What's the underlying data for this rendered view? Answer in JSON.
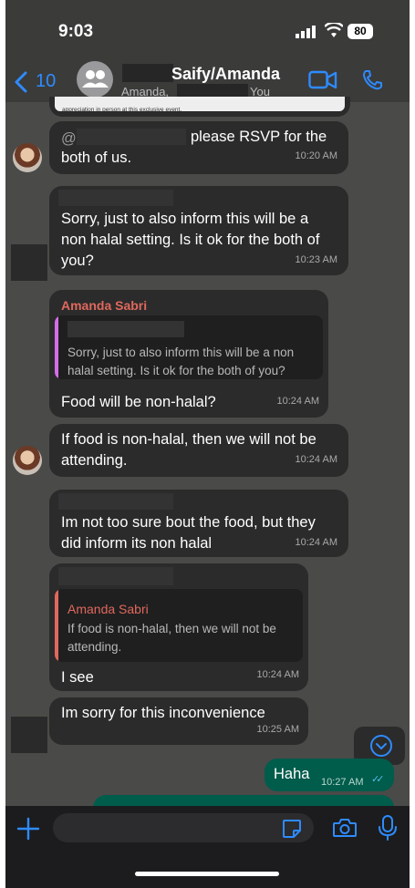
{
  "status_bar": {
    "time": "9:03",
    "battery": "80"
  },
  "header": {
    "back_count": "10",
    "title": "Saify/Amanda",
    "members_prefix": "Amanda,",
    "members_suffix": "You",
    "top_snippet": "appreciation in person at this exclusive event."
  },
  "messages": [
    {
      "id": "m1",
      "at": "@",
      "text": "please RSVP for the",
      "text2": "both of us.",
      "time": "10:20 AM"
    },
    {
      "id": "m2",
      "lines": [
        "Sorry, just to also inform this will be a",
        "non halal setting. Is it ok for the both of",
        "you?"
      ],
      "time": "10:23 AM"
    },
    {
      "id": "m3",
      "sender": "Amanda Sabri",
      "quote_lines": [
        "Sorry, just to also inform this will be a non",
        "halal setting. Is it ok for the both of you?"
      ],
      "text": "Food will be non-halal?",
      "time": "10:24 AM"
    },
    {
      "id": "m4",
      "lines": [
        "If food is non-halal, then we will not be",
        "attending."
      ],
      "time": "10:24 AM"
    },
    {
      "id": "m5",
      "lines": [
        "Im not too sure bout the food, but they",
        "did inform its non halal"
      ],
      "time": "10:24 AM"
    },
    {
      "id": "m6",
      "quote_name": "Amanda Sabri",
      "quote_lines": [
        "If food is non-halal, then we will not be",
        "attending."
      ],
      "text": "I see",
      "time": "10:24 AM"
    },
    {
      "id": "m7",
      "text": "Im sorry for this inconvenience",
      "time": "10:25 AM"
    },
    {
      "id": "m8",
      "text": "Haha",
      "time": "10:27 AM",
      "read_ticks": "✓✓"
    }
  ],
  "colors": {
    "accent": "#2e8bff",
    "outgoing": "#005c4b",
    "incoming": "#2b2b2b",
    "quote_name": "#e0685d"
  },
  "icons": [
    "back-chevron-icon",
    "group-avatar-icon",
    "video-call-icon",
    "phone-icon",
    "scroll-down-icon",
    "plus-icon",
    "sticker-icon",
    "camera-icon",
    "microphone-icon"
  ]
}
